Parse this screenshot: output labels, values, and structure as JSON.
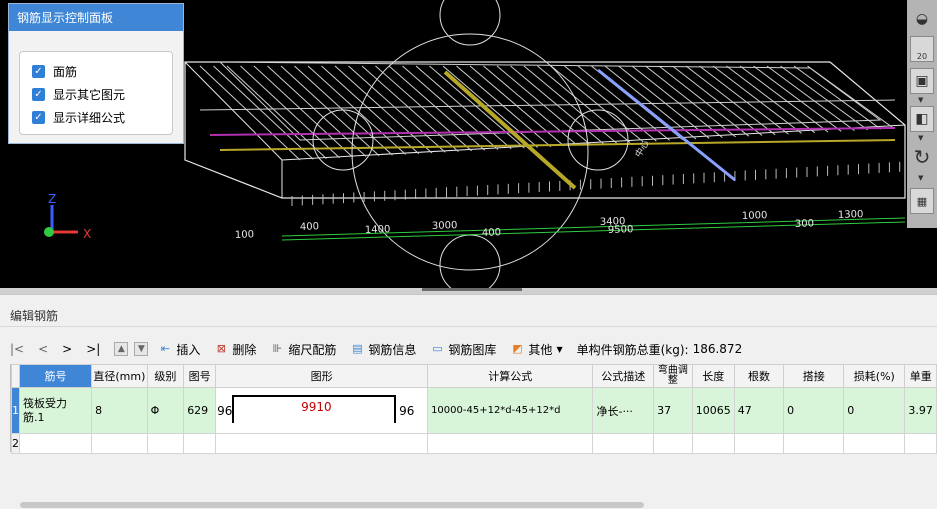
{
  "panel": {
    "title": "钢筋显示控制面板",
    "options": [
      {
        "label": "面筋",
        "checked": true
      },
      {
        "label": "显示其它图元",
        "checked": true
      },
      {
        "label": "显示详细公式",
        "checked": true
      }
    ]
  },
  "axes": {
    "x": "X",
    "z": "Z"
  },
  "dimensions": [
    "100",
    "400",
    "1400",
    "3000",
    "400",
    "3400",
    "9500",
    "1000",
    "1300",
    "300"
  ],
  "colors": {
    "accent": "#3f86d6",
    "row_selected": "#d9f5d9",
    "shape_value": "#c00000",
    "rebar_yellow": "#b8a828",
    "rebar_magenta": "#b030b0",
    "rebar_blue": "#8aa0ff"
  },
  "right_toolbar": {
    "zoom_value": "20"
  },
  "editor": {
    "title": "编辑钢筋",
    "toolbar": {
      "first": "|<",
      "prev": "<",
      "next": ">",
      "last": ">|",
      "insert": "插入",
      "delete": "删除",
      "scale": "缩尺配筋",
      "info": "钢筋信息",
      "library": "钢筋图库",
      "other": "其他",
      "total_label": "单构件钢筋总重(kg):",
      "total_value": "186.872"
    },
    "columns": [
      "筋号",
      "直径(mm)",
      "级别",
      "图号",
      "图形",
      "计算公式",
      "公式描述",
      "弯曲调整",
      "长度",
      "根数",
      "搭接",
      "损耗(%)",
      "单重"
    ],
    "rows": [
      {
        "index": "1",
        "name": "筏板受力筋.1",
        "diameter": "8",
        "grade": "Φ",
        "figure_no": "629",
        "shape_left": "96",
        "shape_mid": "9910",
        "shape_right": "96",
        "formula": "10000-45+12*d-45+12*d",
        "desc": "净长-···",
        "bend": "37",
        "length": "10065",
        "count": "47",
        "lap": "0",
        "loss": "0",
        "unit_weight": "3.97"
      }
    ],
    "empty_row_index": "2"
  }
}
